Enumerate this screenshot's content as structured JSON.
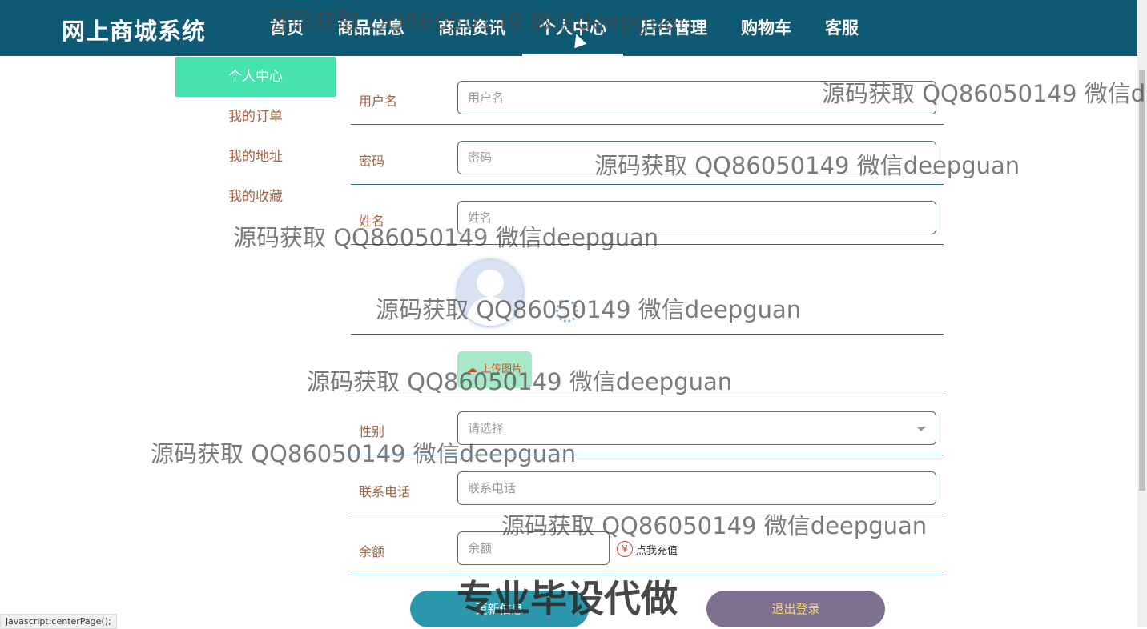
{
  "brand": "网上商城系统",
  "nav": [
    "首页",
    "商品信息",
    "商品资讯",
    "个人中心",
    "后台管理",
    "购物车",
    "客服"
  ],
  "sidebar": [
    "个人中心",
    "我的订单",
    "我的地址",
    "我的收藏"
  ],
  "form": {
    "username": {
      "label": "用户名",
      "placeholder": "用户名"
    },
    "password": {
      "label": "密码",
      "placeholder": "密码"
    },
    "name": {
      "label": "姓名",
      "placeholder": "姓名"
    },
    "upload_label": "上传图片",
    "gender": {
      "label": "性别",
      "placeholder": "请选择"
    },
    "phone": {
      "label": "联系电话",
      "placeholder": "联系电话"
    },
    "balance": {
      "label": "余额",
      "placeholder": "余额"
    },
    "recharge": "点我充值",
    "yen": "¥"
  },
  "buttons": {
    "update": "更新信息",
    "logout": "退出登录"
  },
  "status_url": "javascript:centerPage();",
  "watermark": "源码获取 QQ86050149 微信deepguan",
  "watermark_cut": "源码获取 QQ86050149 微信d",
  "watermark_big": "专业毕设代做"
}
